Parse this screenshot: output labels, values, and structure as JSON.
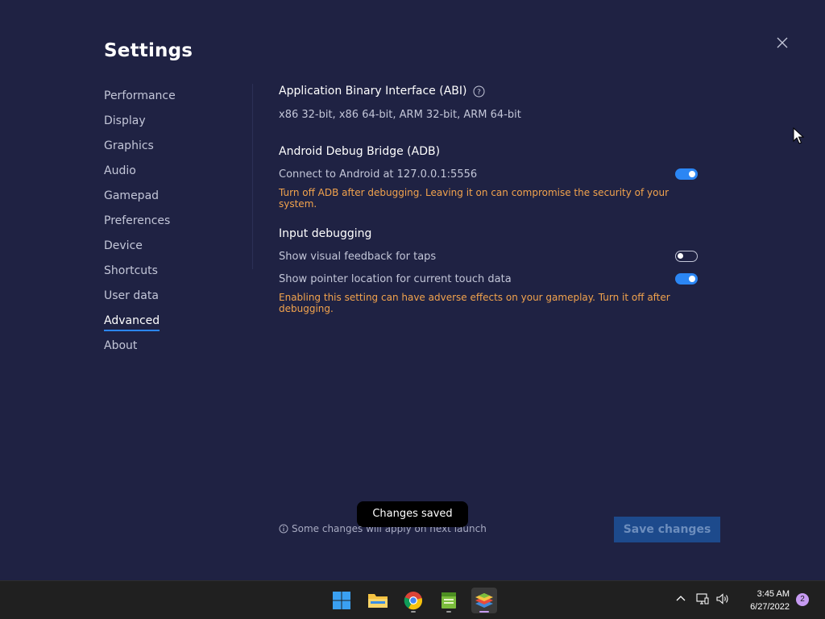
{
  "settings": {
    "title": "Settings",
    "nav": [
      {
        "label": "Performance"
      },
      {
        "label": "Display"
      },
      {
        "label": "Graphics"
      },
      {
        "label": "Audio"
      },
      {
        "label": "Gamepad"
      },
      {
        "label": "Preferences"
      },
      {
        "label": "Device"
      },
      {
        "label": "Shortcuts"
      },
      {
        "label": "User data"
      },
      {
        "label": "Advanced",
        "active": true
      },
      {
        "label": "About"
      }
    ],
    "abi": {
      "title": "Application Binary Interface (ABI)",
      "value": "x86 32-bit, x86 64-bit, ARM 32-bit, ARM 64-bit"
    },
    "adb": {
      "title": "Android Debug Bridge (ADB)",
      "connect_label": "Connect to Android at 127.0.0.1:5556",
      "connect_enabled": true,
      "warning": "Turn off ADB after debugging. Leaving it on can compromise the security of your system."
    },
    "input_debugging": {
      "title": "Input debugging",
      "visual_feedback_label": "Show visual feedback for taps",
      "visual_feedback_enabled": false,
      "pointer_location_label": "Show pointer location for current touch data",
      "pointer_location_enabled": true,
      "warning": "Enabling this setting can have adverse effects on your gameplay. Turn it off after debugging."
    },
    "footer_note": "Some changes will apply on next launch",
    "toast": "Changes saved",
    "save_label": "Save changes"
  },
  "taskbar": {
    "time": "3:45 AM",
    "date": "6/27/2022",
    "notification_count": "2"
  },
  "colors": {
    "background": "#1f2243",
    "accent": "#2b86f4",
    "warning": "#f2a34d"
  }
}
